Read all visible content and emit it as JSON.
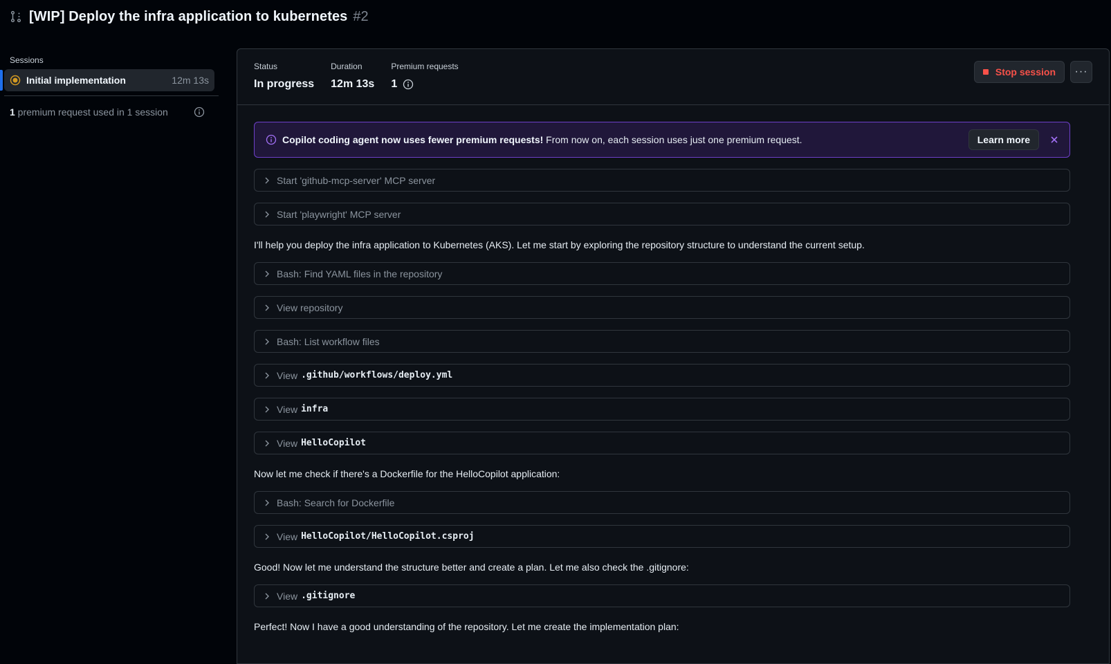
{
  "header": {
    "title": "[WIP] Deploy the infra application to kubernetes",
    "number": "#2"
  },
  "sidebar": {
    "sessions_label": "Sessions",
    "session": {
      "name": "Initial implementation",
      "duration": "12m 13s"
    },
    "usage": {
      "count": "1",
      "text": " premium request used in 1 session"
    }
  },
  "stats": {
    "status_label": "Status",
    "status_value": "In progress",
    "duration_label": "Duration",
    "duration_value": "12m 13s",
    "premium_label": "Premium requests",
    "premium_value": "1"
  },
  "actions": {
    "stop_label": "Stop session",
    "more_label": "···"
  },
  "banner": {
    "bold": "Copilot coding agent now uses fewer premium requests!",
    "text": " From now on, each session uses just one premium request.",
    "learn_more": "Learn more"
  },
  "log": {
    "step1": "Start 'github-mcp-server' MCP server",
    "step2": "Start 'playwright' MCP server",
    "para1": "I'll help you deploy the infra application to Kubernetes (AKS). Let me start by exploring the repository structure to understand the current setup.",
    "step3": "Bash: Find YAML files in the repository",
    "step4": "View repository",
    "step5": "Bash: List workflow files",
    "view": "View",
    "step6_code": ".github/workflows/deploy.yml",
    "step7_code": "infra",
    "step8_code": "HelloCopilot",
    "para2": "Now let me check if there's a Dockerfile for the HelloCopilot application:",
    "step9": "Bash: Search for Dockerfile",
    "step10_code": "HelloCopilot/HelloCopilot.csproj",
    "para3": "Good! Now let me understand the structure better and create a plan. Let me also check the .gitignore:",
    "step11_code": ".gitignore",
    "para4": "Perfect! Now I have a good understanding of the repository. Let me create the implementation plan:"
  },
  "colors": {
    "accent": "#1f6feb",
    "danger": "#f85149",
    "banner_border": "#6e40c9",
    "in_progress": "#d29922"
  }
}
